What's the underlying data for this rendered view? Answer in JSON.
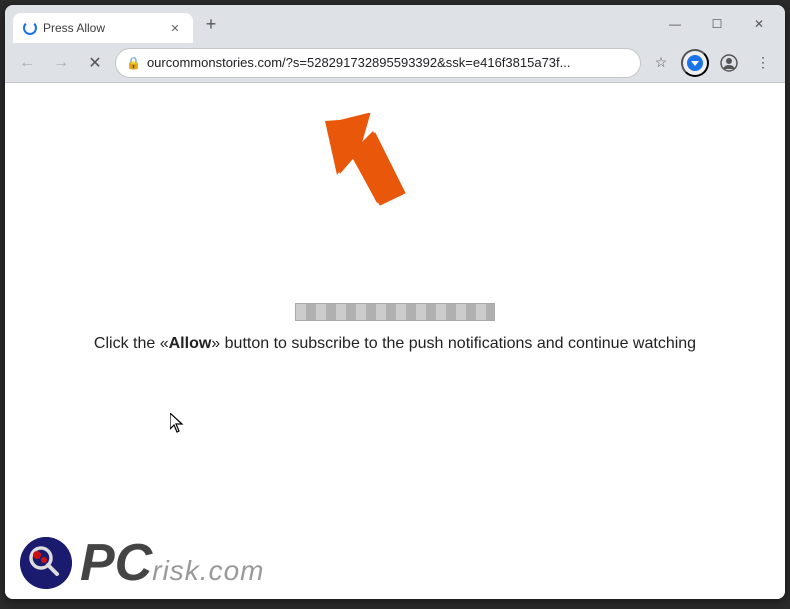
{
  "window": {
    "title": "Press Allow",
    "tab_title": "Press Allow",
    "url": "ourcommonstories.com/?s=528291732895593392&ssk=e416f3815a73f...",
    "new_tab_label": "+",
    "controls": {
      "minimize": "—",
      "maximize": "☐",
      "close": "✕"
    }
  },
  "nav": {
    "back_title": "back",
    "forward_title": "forward",
    "reload_title": "reload",
    "lock_symbol": "🔒",
    "star_symbol": "☆",
    "profile_symbol": "👤",
    "menu_symbol": "⋮",
    "downloads_symbol": "⬇"
  },
  "page": {
    "cta_text": "Click the «Allow» button to subscribe to the push notifications and continue watching",
    "arrow_direction": "upper-left"
  },
  "pcrisk": {
    "brand": "PC",
    "suffix": "risk.com"
  }
}
